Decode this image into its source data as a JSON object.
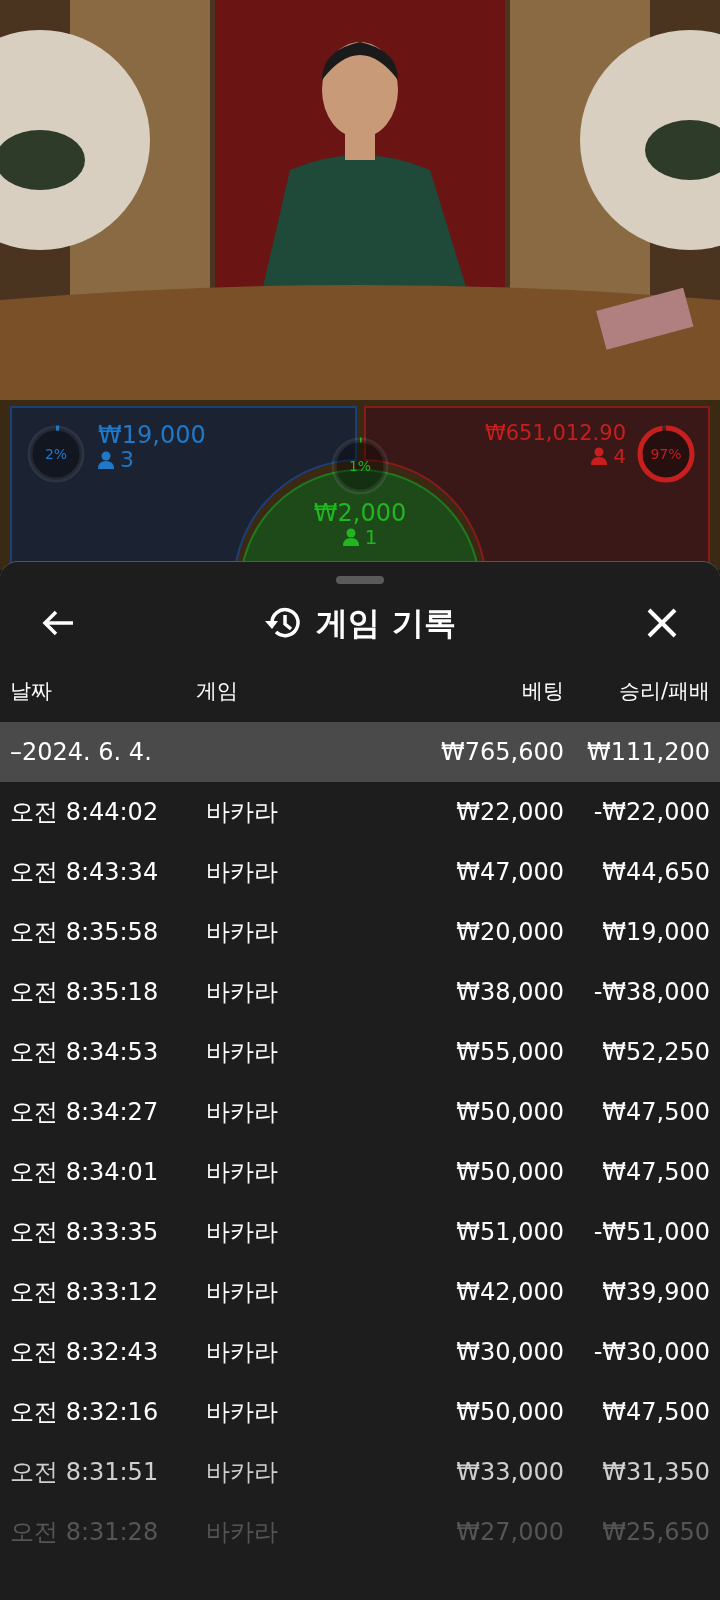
{
  "bets": {
    "player": {
      "amount": "₩19,000",
      "players": "3",
      "percent": "2%",
      "level": 0.02
    },
    "tie": {
      "amount": "₩2,000",
      "players": "1",
      "percent": "1%",
      "level": 0.01
    },
    "banker": {
      "amount": "₩651,012.90",
      "players": "4",
      "percent": "97%",
      "level": 0.97
    }
  },
  "sheet": {
    "title": "게임 기록",
    "columns": [
      "날짜",
      "게임",
      "베팅",
      "승리/패배"
    ],
    "summary": {
      "date": "–2024. 6. 4.",
      "bet": "₩765,600",
      "result": "₩111,200"
    },
    "rows": [
      {
        "time": "오전 8:44:02",
        "game": "바카라",
        "bet": "₩22,000",
        "result": "-₩22,000"
      },
      {
        "time": "오전 8:43:34",
        "game": "바카라",
        "bet": "₩47,000",
        "result": "₩44,650"
      },
      {
        "time": "오전 8:35:58",
        "game": "바카라",
        "bet": "₩20,000",
        "result": "₩19,000"
      },
      {
        "time": "오전 8:35:18",
        "game": "바카라",
        "bet": "₩38,000",
        "result": "-₩38,000"
      },
      {
        "time": "오전 8:34:53",
        "game": "바카라",
        "bet": "₩55,000",
        "result": "₩52,250"
      },
      {
        "time": "오전 8:34:27",
        "game": "바카라",
        "bet": "₩50,000",
        "result": "₩47,500"
      },
      {
        "time": "오전 8:34:01",
        "game": "바카라",
        "bet": "₩50,000",
        "result": "₩47,500"
      },
      {
        "time": "오전 8:33:35",
        "game": "바카라",
        "bet": "₩51,000",
        "result": "-₩51,000"
      },
      {
        "time": "오전 8:33:12",
        "game": "바카라",
        "bet": "₩42,000",
        "result": "₩39,900"
      },
      {
        "time": "오전 8:32:43",
        "game": "바카라",
        "bet": "₩30,000",
        "result": "-₩30,000"
      },
      {
        "time": "오전 8:32:16",
        "game": "바카라",
        "bet": "₩50,000",
        "result": "₩47,500"
      },
      {
        "time": "오전 8:31:51",
        "game": "바카라",
        "bet": "₩33,000",
        "result": "₩31,350"
      },
      {
        "time": "오전 8:31:28",
        "game": "바카라",
        "bet": "₩27,000",
        "result": "₩25,650"
      }
    ]
  }
}
